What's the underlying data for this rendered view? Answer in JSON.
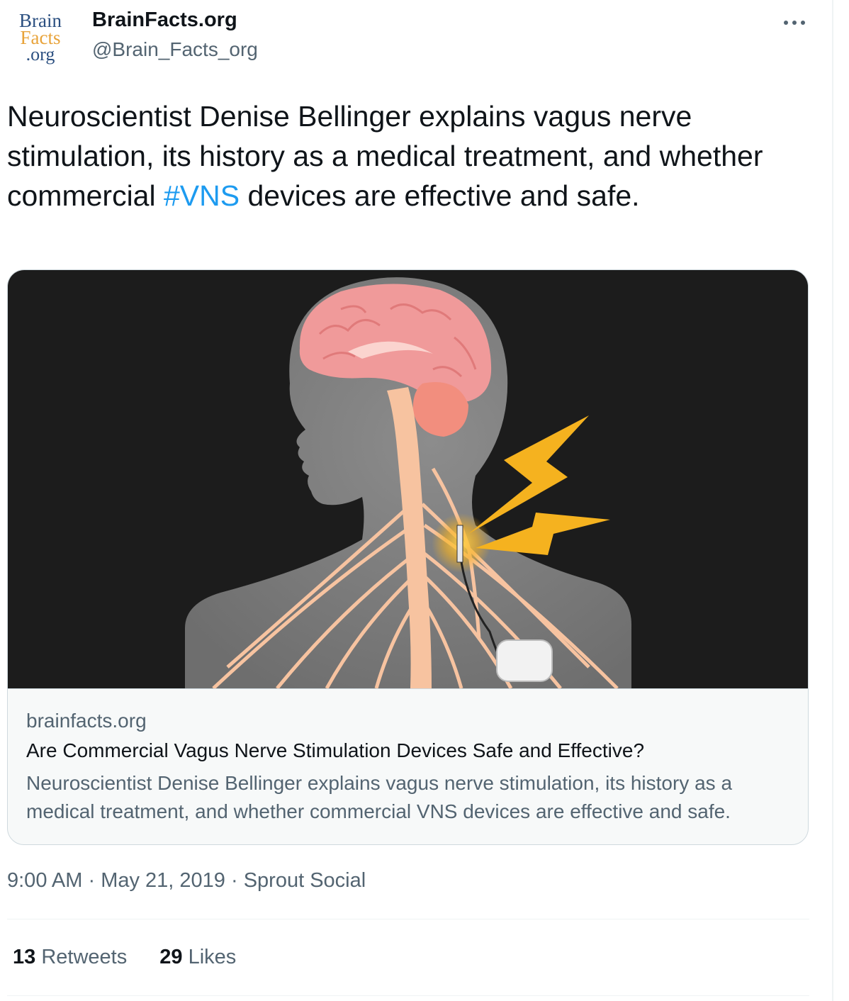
{
  "author": {
    "avatar_lines": [
      "Brain",
      "Facts",
      ".org"
    ],
    "display_name": "BrainFacts.org",
    "handle": "@Brain_Facts_org"
  },
  "tweet": {
    "text_before": "Neuroscientist Denise Bellinger explains vagus nerve stimulation, its history as a medical treatment, and whether commercial ",
    "hashtag": "#VNS",
    "text_after": " devices are effective and safe."
  },
  "card": {
    "domain": "brainfacts.org",
    "title": "Are Commercial Vagus Nerve Stimulation Devices Safe and Effective?",
    "description": "Neuroscientist Denise Bellinger explains vagus nerve stimulation, its history as a medical treatment, and whether commercial VNS devices are effective and safe."
  },
  "meta": {
    "time": "9:00 AM",
    "separator": " · ",
    "date": "May 21, 2019",
    "source": "Sprout Social"
  },
  "stats": {
    "retweets_count": "13",
    "retweets_label": "Retweets",
    "likes_count": "29",
    "likes_label": "Likes"
  },
  "colors": {
    "link": "#1d9bf0",
    "secondary_text": "#536471",
    "lightning": "#f5b21f",
    "brain": "#f09a9a",
    "nerves": "#f7c3a0"
  },
  "icons": {
    "more": "more-horizontal-icon"
  }
}
